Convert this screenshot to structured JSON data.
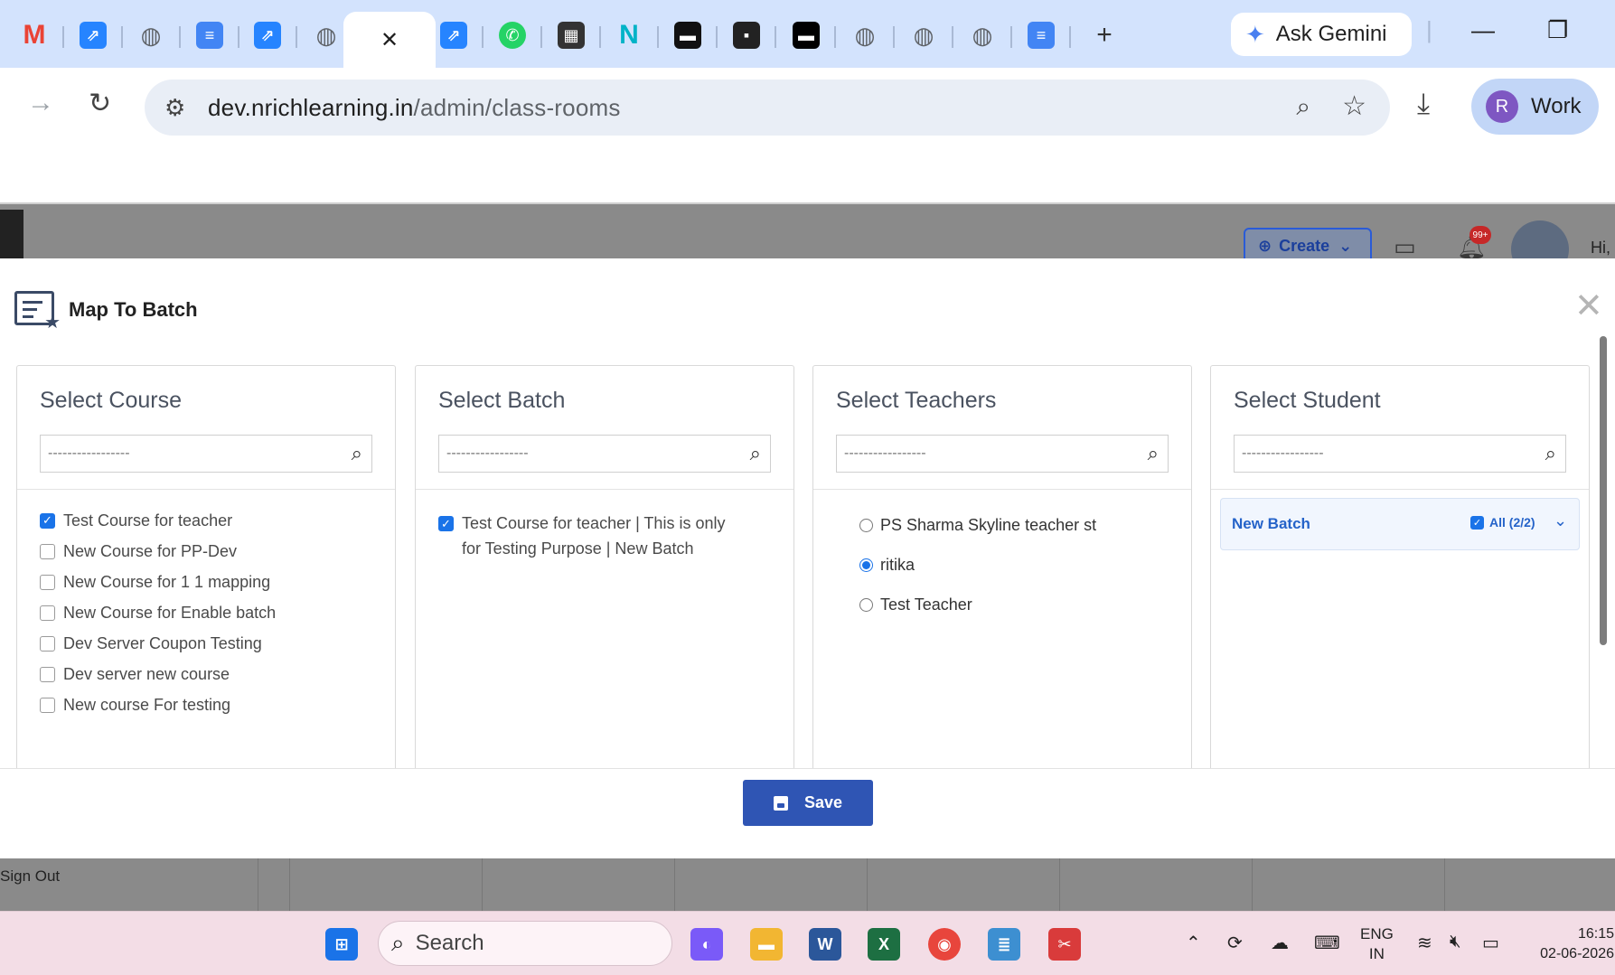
{
  "browser": {
    "tabs": [
      {
        "icon": "gmail-icon",
        "glyph": "M",
        "color": "#ea4335"
      },
      {
        "icon": "jira-icon",
        "glyph": "⇗",
        "color": "#2684ff"
      },
      {
        "icon": "globe-icon",
        "glyph": "◍",
        "color": "#5f6368"
      },
      {
        "icon": "docs-icon",
        "glyph": "≡",
        "color": "#4285f4"
      },
      {
        "icon": "jira-icon",
        "glyph": "⇗",
        "color": "#2684ff"
      },
      {
        "icon": "globe-icon",
        "glyph": "◍",
        "color": "#5f6368"
      },
      {
        "icon": "close-icon",
        "glyph": "✕",
        "color": "#ffffff"
      },
      {
        "icon": "jira-icon",
        "glyph": "⇗",
        "color": "#2684ff"
      },
      {
        "icon": "whatsapp-icon",
        "glyph": "✆",
        "color": "#25d366"
      },
      {
        "icon": "thumbnail-icon",
        "glyph": "▦",
        "color": "#333333"
      },
      {
        "icon": "n-logo-icon",
        "glyph": "N",
        "color": "#00b3c7"
      },
      {
        "icon": "thumbnail-icon",
        "glyph": "▬",
        "color": "#111111"
      },
      {
        "icon": "thumbnail-icon",
        "glyph": "▪",
        "color": "#222222"
      },
      {
        "icon": "thumbnail-icon",
        "glyph": "▬",
        "color": "#000000"
      },
      {
        "icon": "globe-icon",
        "glyph": "◍",
        "color": "#5f6368"
      },
      {
        "icon": "globe-icon",
        "glyph": "◍",
        "color": "#5f6368"
      },
      {
        "icon": "globe-icon",
        "glyph": "◍",
        "color": "#5f6368"
      },
      {
        "icon": "docs-icon",
        "glyph": "≡",
        "color": "#4285f4"
      }
    ],
    "new_tab": "+",
    "gemini_label": "Ask Gemini",
    "url_host": "dev.nrichlearning.in",
    "url_path": "/admin/class-rooms",
    "profile_initial": "R",
    "profile_label": "Work"
  },
  "app": {
    "create_label": "Create",
    "notif_badge": "99+",
    "greeting": "Hi, !",
    "signout": "Sign Out"
  },
  "modal": {
    "title": "Map To Batch",
    "search_placeholder": "-----------------",
    "course": {
      "title": "Select Course",
      "items": [
        {
          "label": "Test Course for teacher",
          "checked": true
        },
        {
          "label": "New Course for PP-Dev",
          "checked": false
        },
        {
          "label": "New Course for 1 1 mapping",
          "checked": false
        },
        {
          "label": "New Course for Enable batch",
          "checked": false
        },
        {
          "label": "Dev Server Coupon Testing",
          "checked": false
        },
        {
          "label": "Dev server new course",
          "checked": false
        },
        {
          "label": "New course For testing",
          "checked": false
        }
      ]
    },
    "batch": {
      "title": "Select Batch",
      "items": [
        {
          "label": "Test Course for teacher | This is only for Testing Purpose | New Batch",
          "checked": true
        }
      ]
    },
    "teachers": {
      "title": "Select Teachers",
      "items": [
        {
          "label": "PS Sharma Skyline teacher st",
          "selected": false
        },
        {
          "label": "ritika",
          "selected": true
        },
        {
          "label": "Test Teacher",
          "selected": false
        }
      ]
    },
    "student": {
      "title": "Select Student",
      "batch_name": "New Batch",
      "all_label": "All (2/2)"
    },
    "save_label": "Save"
  },
  "taskbar": {
    "search_label": "Search",
    "lang_line1": "ENG",
    "lang_line2": "IN",
    "time": "16:15",
    "date": "02-06-2026"
  },
  "colors": {
    "primary": "#2f55b4",
    "check": "#1a73e8",
    "link": "#2563c9"
  }
}
